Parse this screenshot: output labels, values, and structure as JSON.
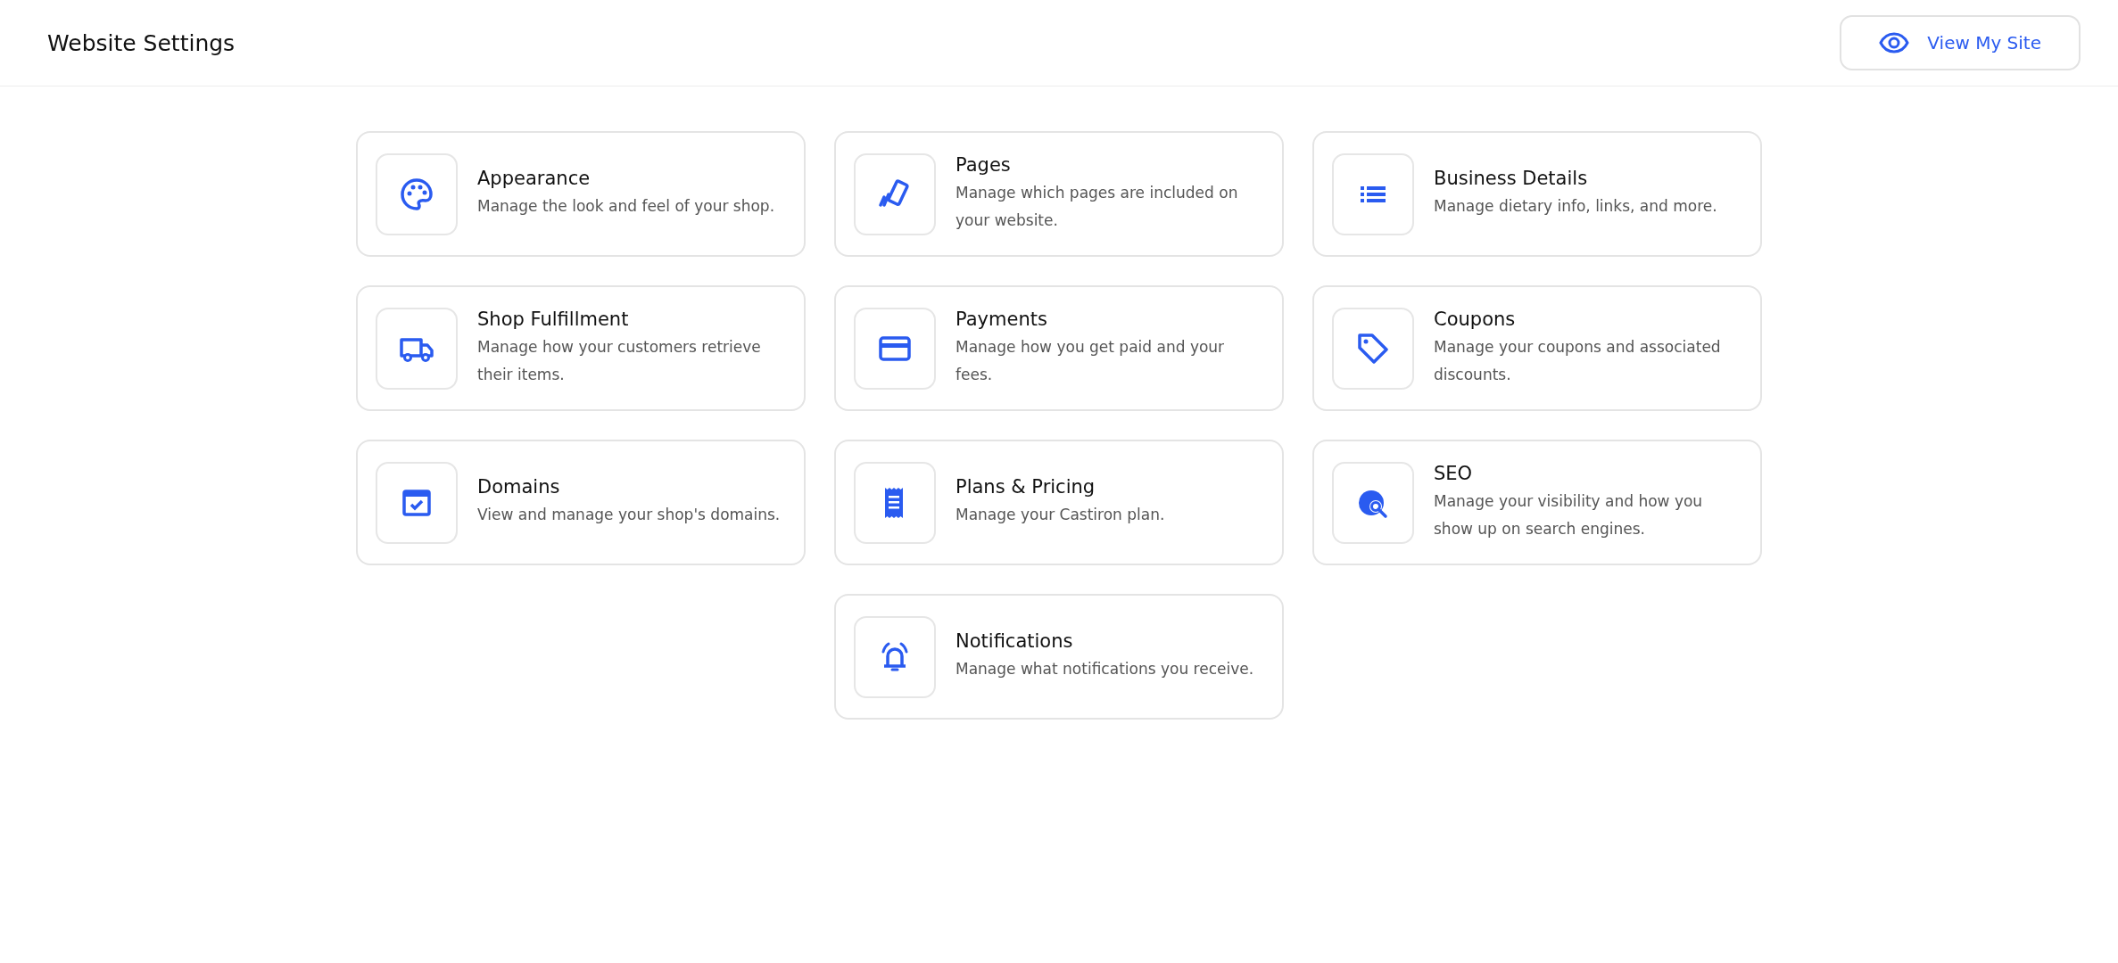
{
  "header": {
    "title": "Website Settings",
    "button": "View My Site"
  },
  "cards": [
    {
      "title": "Appearance",
      "description": "Manage the look and feel of your shop."
    },
    {
      "title": "Pages",
      "description": "Manage which pages are included on your website."
    },
    {
      "title": "Business Details",
      "description": "Manage dietary info, links, and more."
    },
    {
      "title": "Shop Fulfillment",
      "description": "Manage how your customers retrieve their items."
    },
    {
      "title": "Payments",
      "description": "Manage how you get paid and your fees."
    },
    {
      "title": "Coupons",
      "description": "Manage your coupons and associated discounts."
    },
    {
      "title": "Domains",
      "description": "View and manage your shop's domains."
    },
    {
      "title": "Plans & Pricing",
      "description": "Manage your Castiron plan."
    },
    {
      "title": "SEO",
      "description": "Manage your visibility and how you show up on search engines."
    },
    {
      "title": "Notifications",
      "description": "Manage what notifications you receive."
    }
  ]
}
